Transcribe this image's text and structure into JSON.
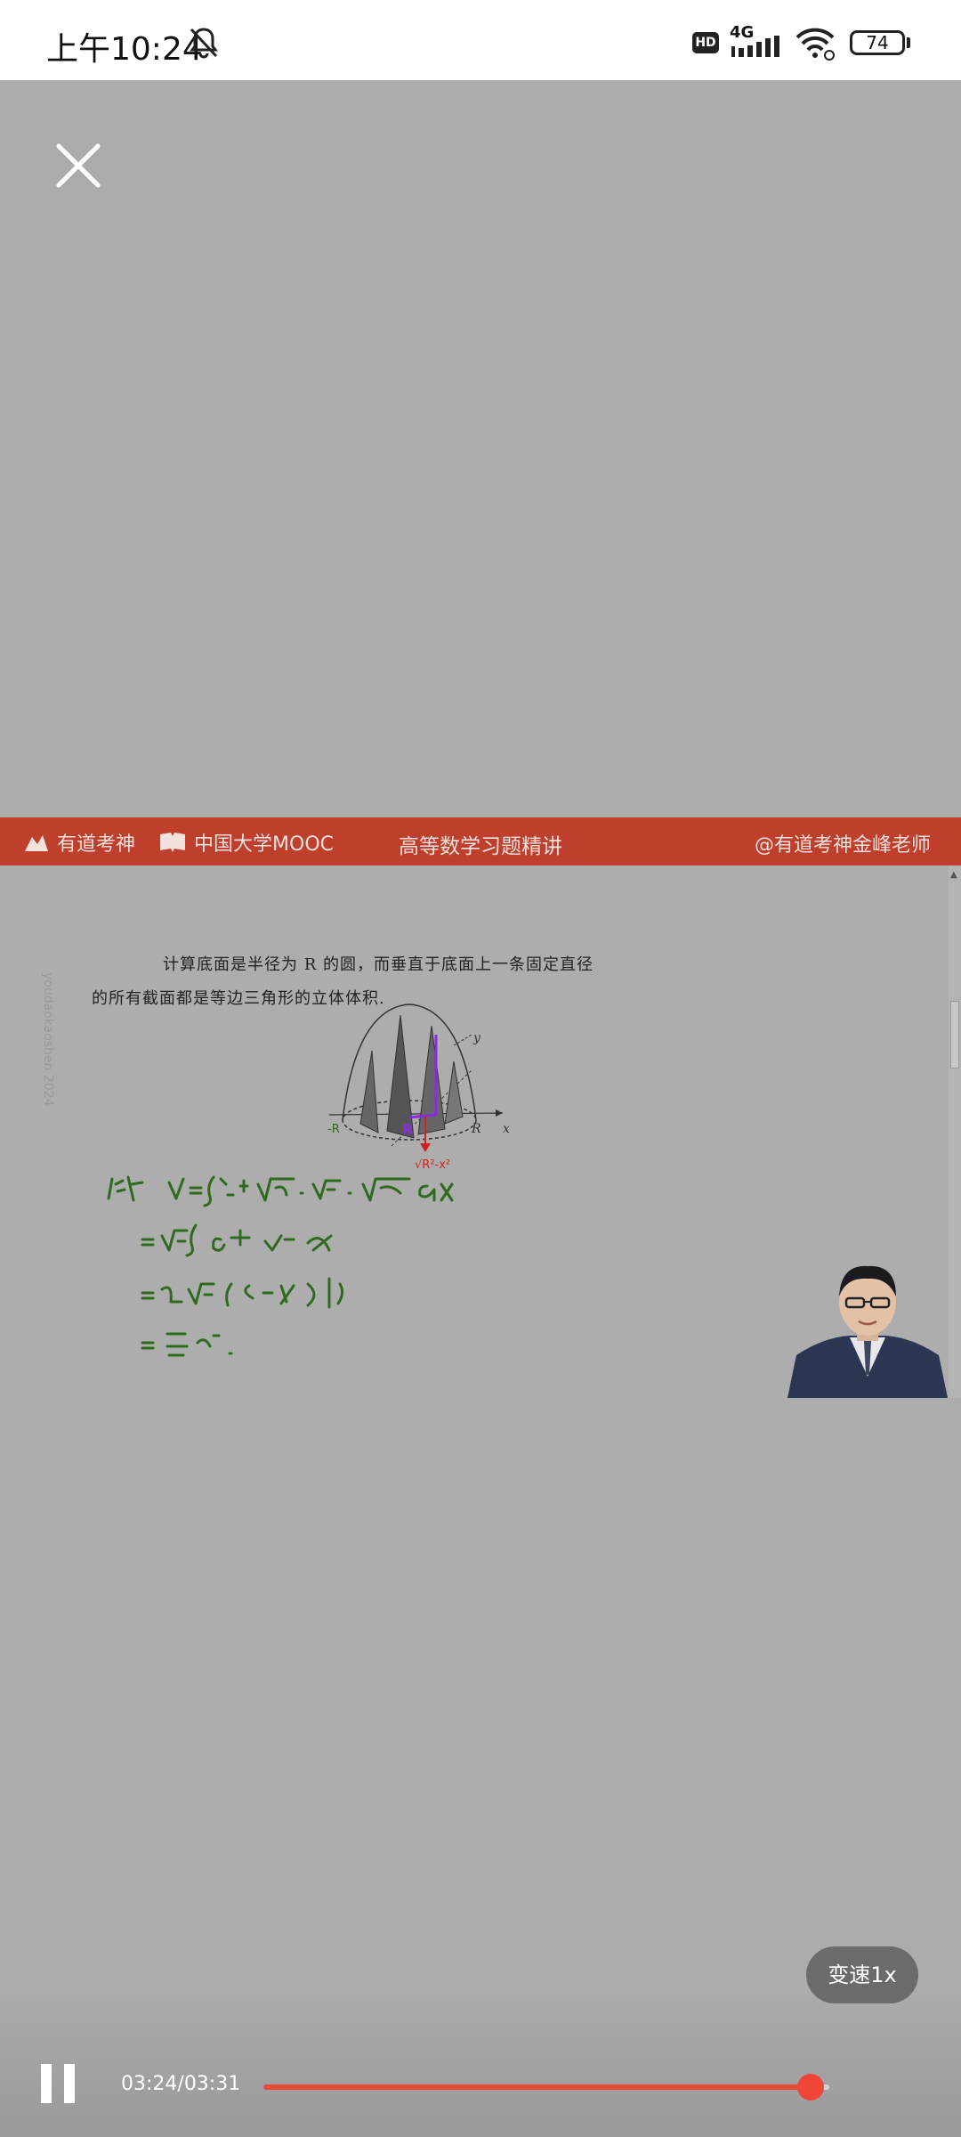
{
  "status_bar": {
    "time": "上午10:24",
    "hd": "HD",
    "network": "4G",
    "battery": "74"
  },
  "video": {
    "brand_left_1": "有道考神",
    "brand_left_2": "中国大学MOOC",
    "title": "高等数学习题精讲",
    "author": "@有道考神金峰老师",
    "problem_line_1": "计算底面是半径为 R 的圆，而垂直于底面上一条固定直径",
    "problem_line_2": "的所有截面都是等边三角形的立体体积.",
    "watermark": "youdaokaoshen 2024"
  },
  "player": {
    "speed_label": "变速1x",
    "time": "03:24/03:31",
    "progress": 0.967
  },
  "colors": {
    "banner": "#bd3f2c",
    "progress": "#f0463a",
    "ink_green": "#2e6b1e"
  }
}
